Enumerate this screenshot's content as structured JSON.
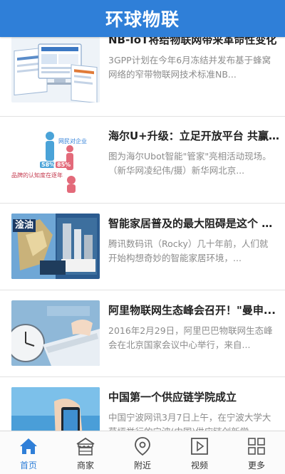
{
  "app": {
    "title": "环球物联"
  },
  "colors": {
    "accent": "#2f7fd8",
    "title_text": "#222222",
    "desc_text": "#8c8c8c"
  },
  "articles": [
    {
      "title": "NB-IoT将给物联网带来革命性变化",
      "desc": "3GPP计划在今年6月冻结并发布基于蜂窝网络的窄带物联网技术标准NB...",
      "thumb": "dashboard-screens-image"
    },
    {
      "title": "海尔U+升级：立足开放平台 共赢...",
      "desc": "图为海尔Ubot智能\"管家\"亮相活动现场。（新华网凌纪伟/摄）新华网北京...",
      "thumb": "smart-home-infographic-image",
      "thumb_text": {
        "line1": "网民对企业",
        "pct_left": "58%",
        "pct_right": "85%",
        "caption": "品牌的认知度在逐年"
      }
    },
    {
      "title": "智能家居普及的最大阻碍是这个 搞...",
      "desc": "腾讯数码讯（Rocky）几十年前，人们就开始构想奇妙的智能家居环境，...",
      "thumb": "smart-home-collage-image",
      "thumb_text": {
        "badge": "淦油"
      }
    },
    {
      "title": "阿里物联网生态峰会召开！\"曼申...",
      "desc": "2016年2月29日，阿里巴巴物联网生态峰会在北京国家会议中心举行，来自...",
      "thumb": "hand-keyboard-image"
    },
    {
      "title": "中国第一个供应链学院成立",
      "desc": "中国宁波网讯3月7日上午，在宁波大学大草坪举行的宁波(中国)供应链创新学...",
      "thumb": "hand-phone-image"
    }
  ],
  "tabs": [
    {
      "label": "首页",
      "icon": "home-icon",
      "active": true
    },
    {
      "label": "商家",
      "icon": "store-icon",
      "active": false
    },
    {
      "label": "附近",
      "icon": "location-pin-icon",
      "active": false
    },
    {
      "label": "视频",
      "icon": "video-play-icon",
      "active": false
    },
    {
      "label": "更多",
      "icon": "grid-more-icon",
      "active": false
    }
  ]
}
